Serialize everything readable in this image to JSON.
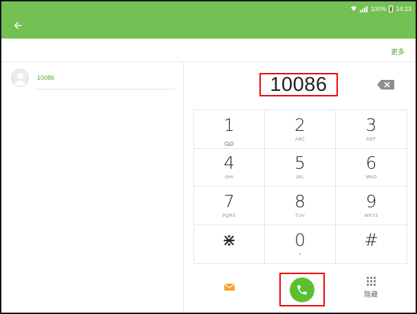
{
  "status_bar": {
    "battery": "100%",
    "time": "14:23"
  },
  "header": {
    "more_label": "更多"
  },
  "search_results": [
    {
      "number": "10086"
    }
  ],
  "dialer": {
    "entered_number": "10086",
    "keys": [
      {
        "digit": "1",
        "letters": ""
      },
      {
        "digit": "2",
        "letters": "ABC"
      },
      {
        "digit": "3",
        "letters": "DEF"
      },
      {
        "digit": "4",
        "letters": "GHI"
      },
      {
        "digit": "5",
        "letters": "JKL"
      },
      {
        "digit": "6",
        "letters": "MNO"
      },
      {
        "digit": "7",
        "letters": "PQRS"
      },
      {
        "digit": "8",
        "letters": "TUV"
      },
      {
        "digit": "9",
        "letters": "WXYZ"
      },
      {
        "digit": "⋇",
        "letters": ""
      },
      {
        "digit": "0",
        "letters": "+"
      },
      {
        "digit": "#",
        "letters": ""
      }
    ],
    "hide_label": "隐藏"
  },
  "colors": {
    "accent": "#73c055",
    "call": "#5bbf2f",
    "highlight": "#e00000"
  }
}
